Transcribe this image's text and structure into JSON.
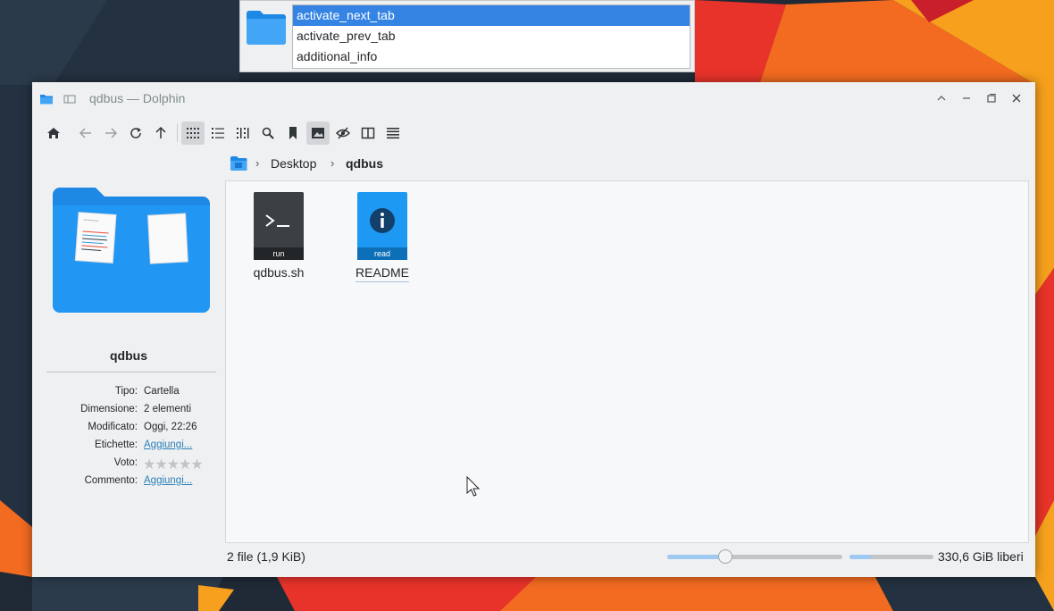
{
  "completion_popup": {
    "items": [
      {
        "label": "activate_next_tab",
        "selected": true
      },
      {
        "label": "activate_prev_tab",
        "selected": false
      },
      {
        "label": "additional_info",
        "selected": false
      }
    ]
  },
  "window": {
    "title": "qdbus — Dolphin",
    "controls": [
      "chevron-up-icon",
      "minimize-icon",
      "maximize-icon",
      "close-icon"
    ]
  },
  "toolbar": {
    "buttons": [
      {
        "name": "home-icon",
        "state": "normal"
      },
      {
        "name": "back-icon",
        "state": "disabled"
      },
      {
        "name": "forward-icon",
        "state": "disabled"
      },
      {
        "name": "reload-icon",
        "state": "normal"
      },
      {
        "name": "up-icon",
        "state": "normal"
      },
      {
        "name": "icons-view-icon",
        "state": "active"
      },
      {
        "name": "compact-view-icon",
        "state": "normal"
      },
      {
        "name": "details-view-icon",
        "state": "normal"
      },
      {
        "name": "search-icon",
        "state": "normal"
      },
      {
        "name": "bookmark-icon",
        "state": "normal"
      },
      {
        "name": "preview-icon",
        "state": "active"
      },
      {
        "name": "hidden-files-icon",
        "state": "normal"
      },
      {
        "name": "split-view-icon",
        "state": "normal"
      },
      {
        "name": "menu-icon",
        "state": "normal"
      }
    ]
  },
  "breadcrumb": {
    "items": [
      "Desktop",
      "qdbus"
    ]
  },
  "info_panel": {
    "name": "qdbus",
    "rows": [
      {
        "key": "Tipo:",
        "value": "Cartella",
        "link": false
      },
      {
        "key": "Dimensione:",
        "value": "2 elementi",
        "link": false
      },
      {
        "key": "Modificato:",
        "value": "Oggi, 22:26",
        "link": false
      },
      {
        "key": "Etichette:",
        "value": "Aggiungi...",
        "link": true
      },
      {
        "key": "Voto:",
        "value": "",
        "rating": 0,
        "max_rating": 5
      },
      {
        "key": "Commento:",
        "value": "Aggiungi...",
        "link": true
      }
    ]
  },
  "files": [
    {
      "name": "qdbus.sh",
      "badge": "run",
      "icon": "terminal-script-icon",
      "color": "#31363b"
    },
    {
      "name": "README",
      "badge": "read",
      "icon": "info-document-icon",
      "color": "#1d99f3"
    }
  ],
  "statusbar": {
    "summary": "2 file (1,9 KiB)",
    "zoom_level": 0.33,
    "free_space_used_fraction": 0.25,
    "free_space": "330,6 GiB liberi"
  },
  "colors": {
    "accent": "#3daee9",
    "selection": "#3584e4",
    "window_bg": "#eff0f1"
  }
}
